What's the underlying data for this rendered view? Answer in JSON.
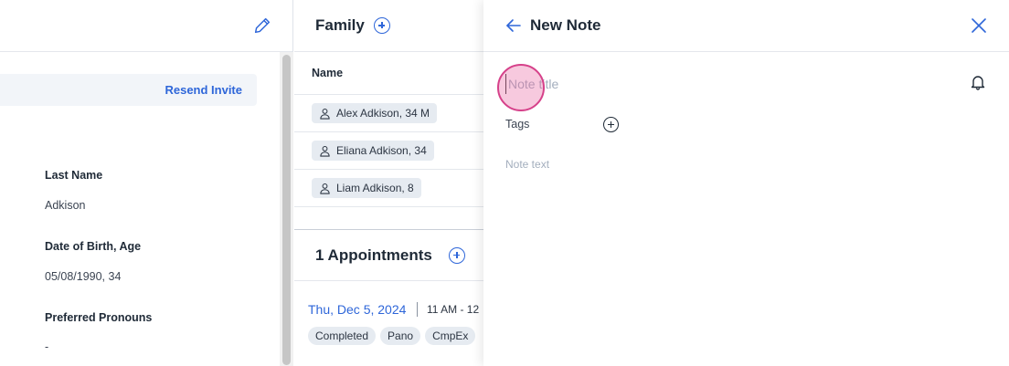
{
  "patient": {
    "resend_invite": "Resend Invite",
    "fields": [
      {
        "label": "Last Name",
        "value": "Adkison"
      },
      {
        "label": "Date of Birth, Age",
        "value": "05/08/1990, 34"
      },
      {
        "label": "Preferred Pronouns",
        "value": "-"
      }
    ]
  },
  "family": {
    "title": "Family",
    "column_name": "Name",
    "members": [
      "Alex Adkison, 34 M",
      "Eliana Adkison, 34",
      "Liam Adkison, 8"
    ]
  },
  "appointments": {
    "title": "1 Appointments",
    "date": "Thu, Dec 5, 2024",
    "time": "11 AM - 12",
    "tags": [
      "Completed",
      "Pano",
      "CmpEx"
    ]
  },
  "note_drawer": {
    "title": "New Note",
    "title_placeholder": "Note title",
    "tags_label": "Tags",
    "text_placeholder": "Note text"
  },
  "colors": {
    "accent": "#2e66d9",
    "chip_bg": "#e6ebf1",
    "click_marker": "#d6418a"
  },
  "icons": [
    "edit-icon",
    "plus-circle-icon",
    "person-icon",
    "back-arrow-icon",
    "close-icon",
    "bell-icon"
  ]
}
